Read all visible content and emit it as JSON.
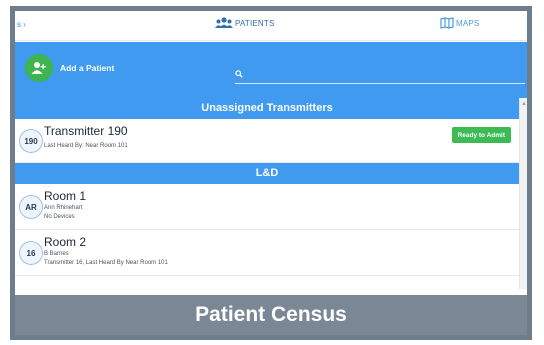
{
  "topnav": {
    "left_stub": "s ›",
    "patients_label": "PATIENTS",
    "maps_label": "MAPS"
  },
  "actionbar": {
    "add_label": "Add a Patient",
    "search_placeholder": "",
    "search_value": ""
  },
  "sections": [
    {
      "title": "Unassigned Transmitters",
      "rows": [
        {
          "badge": "190",
          "title": "Transmitter 190",
          "lines": [
            "Last Heard By: Near Room 101"
          ],
          "action": "Ready to Admit"
        }
      ]
    },
    {
      "title": "L&D",
      "rows": [
        {
          "badge": "AR",
          "title": "Room 1",
          "lines": [
            "Ann Rhinehart",
            "No Devices"
          ]
        },
        {
          "badge": "16",
          "title": "Room 2",
          "lines": [
            "B Barnes",
            "Transmitter 16, Last Heard By Near Room 101"
          ]
        }
      ]
    }
  ],
  "caption": "Patient Census",
  "colors": {
    "brand_blue": "#3f9af0",
    "add_green": "#3fb44f",
    "ready_green": "#3cbb55",
    "caption_gray": "#7a8896",
    "frame": "#6d7d8c"
  }
}
